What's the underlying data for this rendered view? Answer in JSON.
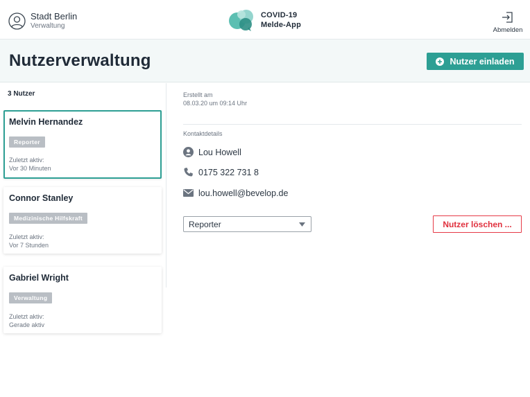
{
  "header": {
    "org_name": "Stadt Berlin",
    "org_sub": "Verwaltung",
    "app_name_line1": "COVID-19",
    "app_name_line2": "Melde-App",
    "logout_label": "Abmelden",
    "icons": {
      "org": "user-circle-icon",
      "logo": "speech-bubbles-logo-icon",
      "logout": "logout-icon"
    }
  },
  "titlebar": {
    "title": "Nutzerverwaltung",
    "invite_label": "Nutzer einladen",
    "invite_icon": "plus-circle-icon"
  },
  "user_list": {
    "count_label": "3 Nutzer",
    "last_active_label": "Zuletzt aktiv:",
    "users": [
      {
        "name": "Melvin Hernandez",
        "role": "Reporter",
        "last_active": "Vor 30 Minuten",
        "selected": true
      },
      {
        "name": "Connor Stanley",
        "role": "Medizinische Hilfskraft",
        "last_active": "Vor 7 Stunden",
        "selected": false
      },
      {
        "name": "Gabriel Wright",
        "role": "Verwaltung",
        "last_active": "Gerade aktiv",
        "selected": false
      }
    ]
  },
  "detail": {
    "created_label": "Erstellt am",
    "created_value": "08.03.20 um 09:14 Uhr",
    "contact_title": "Kontaktdetails",
    "contact": {
      "name": "Lou Howell",
      "phone": "0175 322 731 8",
      "email": "lou.howell@bevelop.de"
    },
    "contact_icons": {
      "name": "person-icon",
      "phone": "phone-icon",
      "email": "mail-icon"
    },
    "role_select": {
      "selected": "Reporter"
    },
    "delete_label": "Nutzer löschen ..."
  },
  "colors": {
    "accent": "#2d9f94",
    "danger": "#e63946",
    "badge": "#b9bec4",
    "titlebar_bg": "#f3f8f8"
  }
}
